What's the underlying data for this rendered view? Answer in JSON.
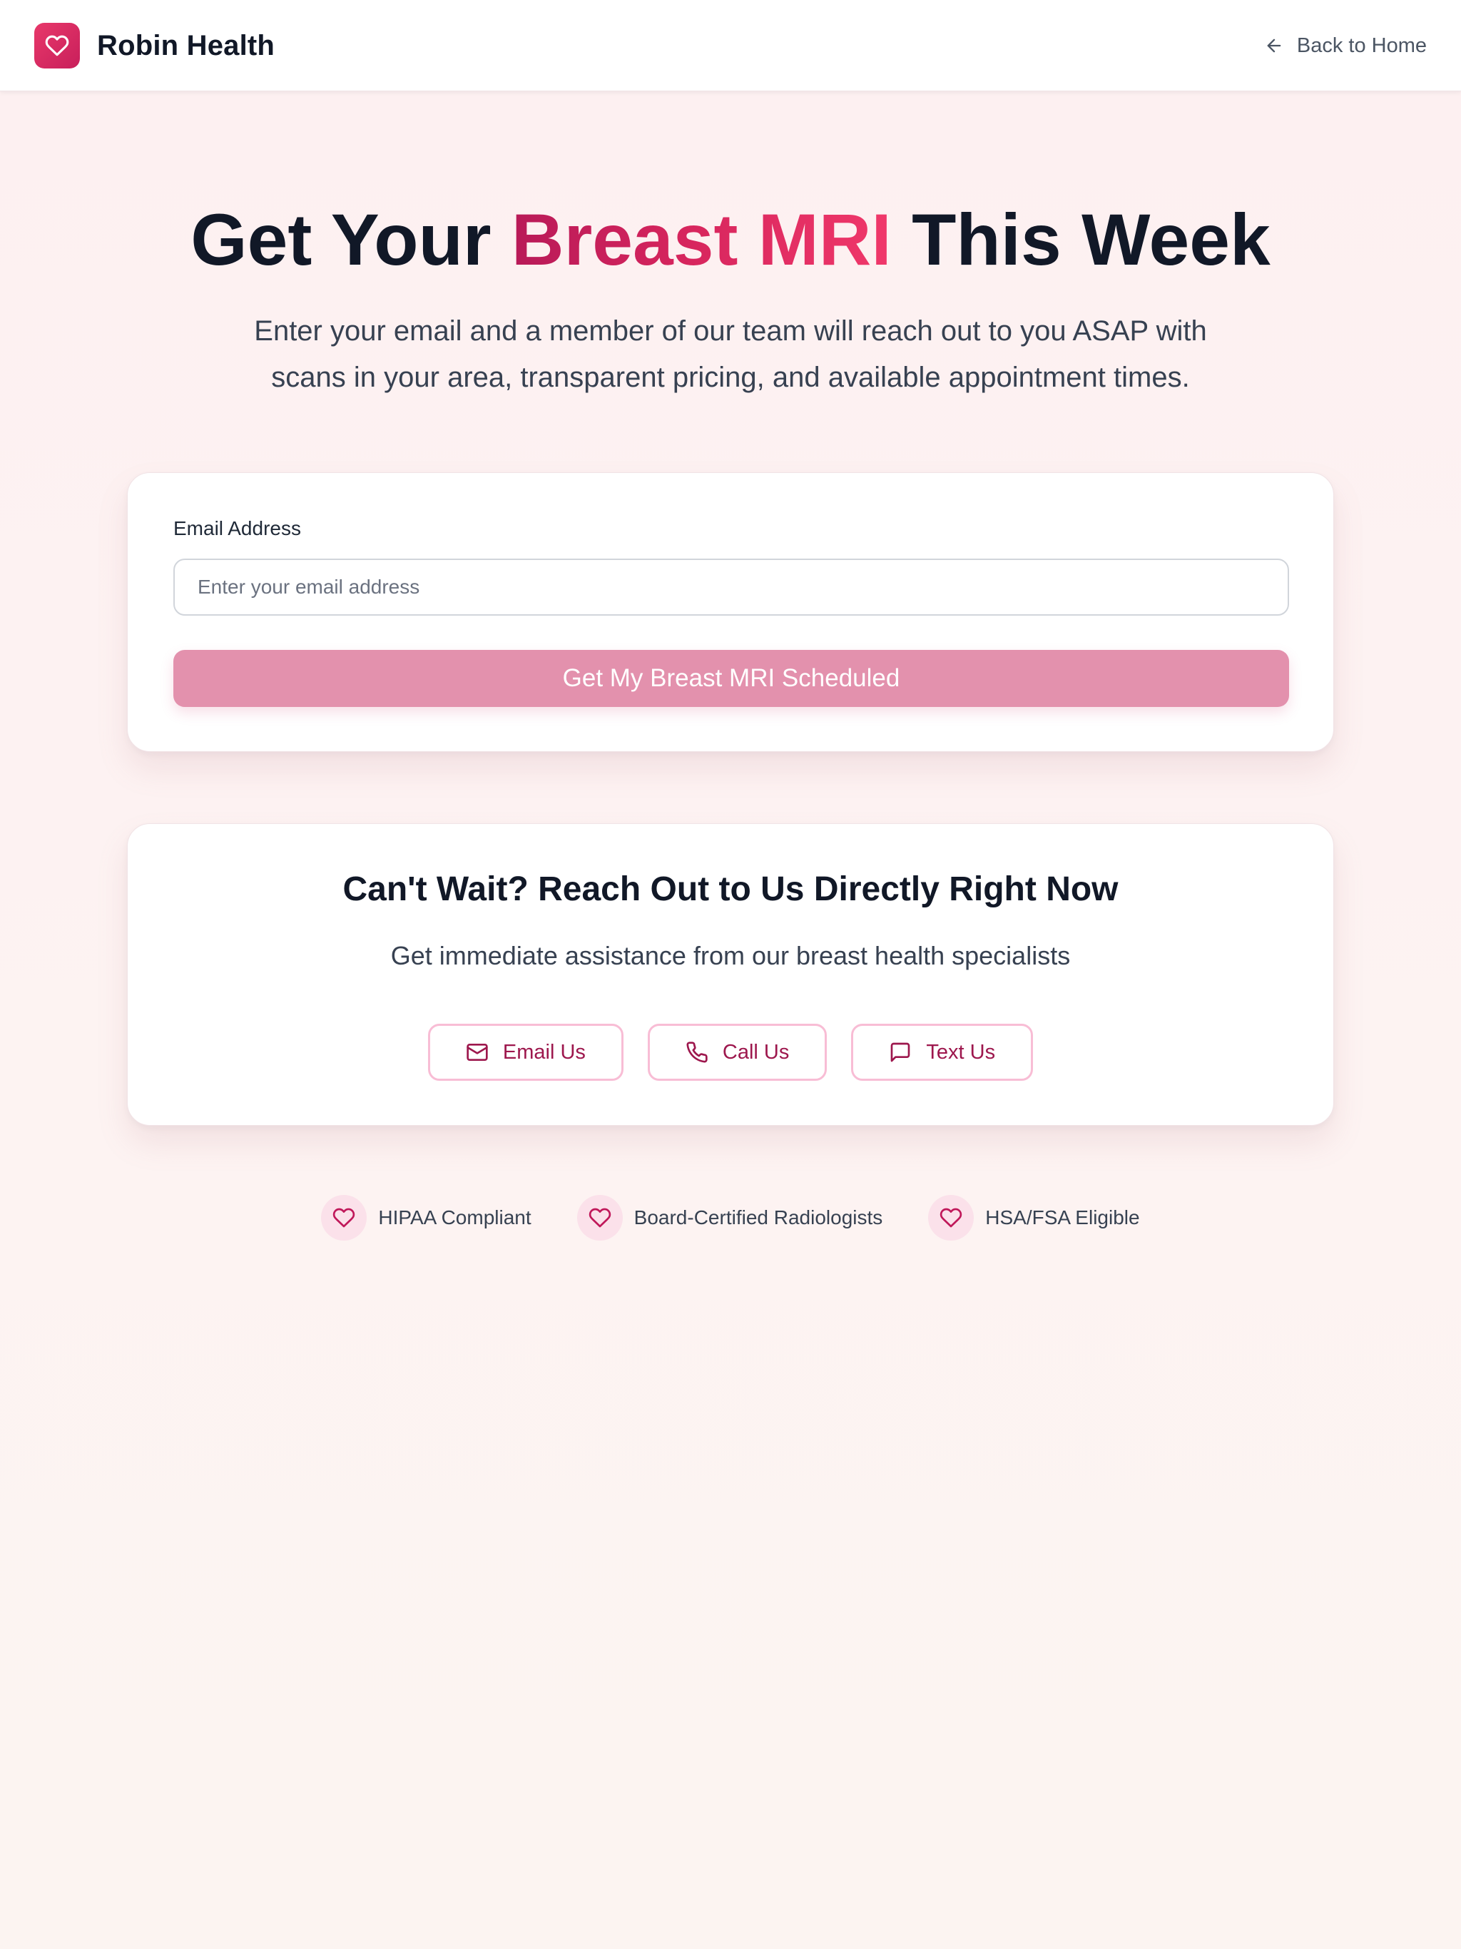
{
  "header": {
    "brand_name": "Robin Health",
    "back_label": "Back to Home",
    "logo_icon": "heart-icon"
  },
  "hero": {
    "title_before": "Get Your ",
    "title_accent": "Breast MRI",
    "title_after": " This Week",
    "subtitle": "Enter your email and a member of our team will reach out to you ASAP with scans in your area, transparent pricing, and available appointment times."
  },
  "form": {
    "email_label": "Email Address",
    "email_value": "",
    "email_placeholder": "Enter your email address",
    "submit_label": "Get My Breast MRI Scheduled"
  },
  "contact": {
    "title": "Can't Wait? Reach Out to Us Directly Right Now",
    "subtitle": "Get immediate assistance from our breast health specialists",
    "buttons": [
      {
        "label": "Email Us",
        "icon": "mail-icon"
      },
      {
        "label": "Call Us",
        "icon": "phone-icon"
      },
      {
        "label": "Text Us",
        "icon": "chat-icon"
      }
    ]
  },
  "badges": [
    {
      "label": "HIPAA Compliant",
      "icon": "heart-icon"
    },
    {
      "label": "Board-Certified Radiologists",
      "icon": "heart-icon"
    },
    {
      "label": "HSA/FSA Eligible",
      "icon": "heart-icon"
    }
  ],
  "colors": {
    "brand_pink": "#d6255d",
    "button_pink": "#e391ad",
    "outline_pink": "#f8bdd5",
    "text_dark": "#111827",
    "text_muted": "#374151"
  }
}
